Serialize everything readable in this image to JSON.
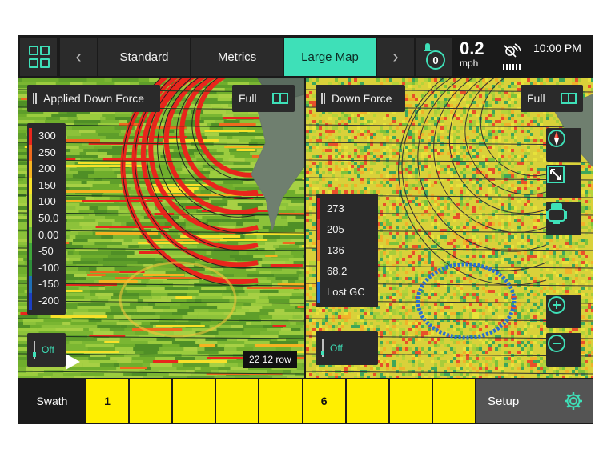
{
  "header": {
    "tabs": [
      {
        "label": "Standard",
        "active": false
      },
      {
        "label": "Metrics",
        "active": false
      },
      {
        "label": "Large Map",
        "active": true
      }
    ],
    "notification_count": "0",
    "speed_value": "0.2",
    "speed_unit": "mph",
    "time": "10:00 PM"
  },
  "left_map": {
    "layer_label": "Applied Down Force",
    "full_label": "Full",
    "legend": [
      {
        "label": "300",
        "color": "#e8261c"
      },
      {
        "label": "250",
        "color": "#ee6a1e"
      },
      {
        "label": "200",
        "color": "#f5b321"
      },
      {
        "label": "150",
        "color": "#f7e12a"
      },
      {
        "label": "100",
        "color": "#d6e238"
      },
      {
        "label": "50.0",
        "color": "#a8d63a"
      },
      {
        "label": "0.00",
        "color": "#6fbf3a"
      },
      {
        "label": "-50",
        "color": "#3ea63a"
      },
      {
        "label": "-100",
        "color": "#2d8f3a"
      },
      {
        "label": "-150",
        "color": "#1f6fb5"
      },
      {
        "label": "-200",
        "color": "#1c3fc2"
      }
    ],
    "off_label": "Off",
    "scale_label": "22 12 row"
  },
  "right_map": {
    "layer_label": "Down Force",
    "full_label": "Full",
    "legend": [
      {
        "label": "273",
        "color": "#c8141c"
      },
      {
        "label": "205",
        "color": "#e0382a"
      },
      {
        "label": "136",
        "color": "#f07a2c"
      },
      {
        "label": "68.2",
        "color": "#f3c12a"
      },
      {
        "label": "Lost GC",
        "color": "#1c6fc8"
      }
    ],
    "off_label": "Off"
  },
  "footer": {
    "swath_label": "Swath",
    "sections": [
      "1",
      "",
      "",
      "",
      "",
      "6",
      "",
      "",
      ""
    ],
    "setup_label": "Setup"
  },
  "colors": {
    "accent": "#3ee0b8",
    "section_on": "#ffef00"
  }
}
